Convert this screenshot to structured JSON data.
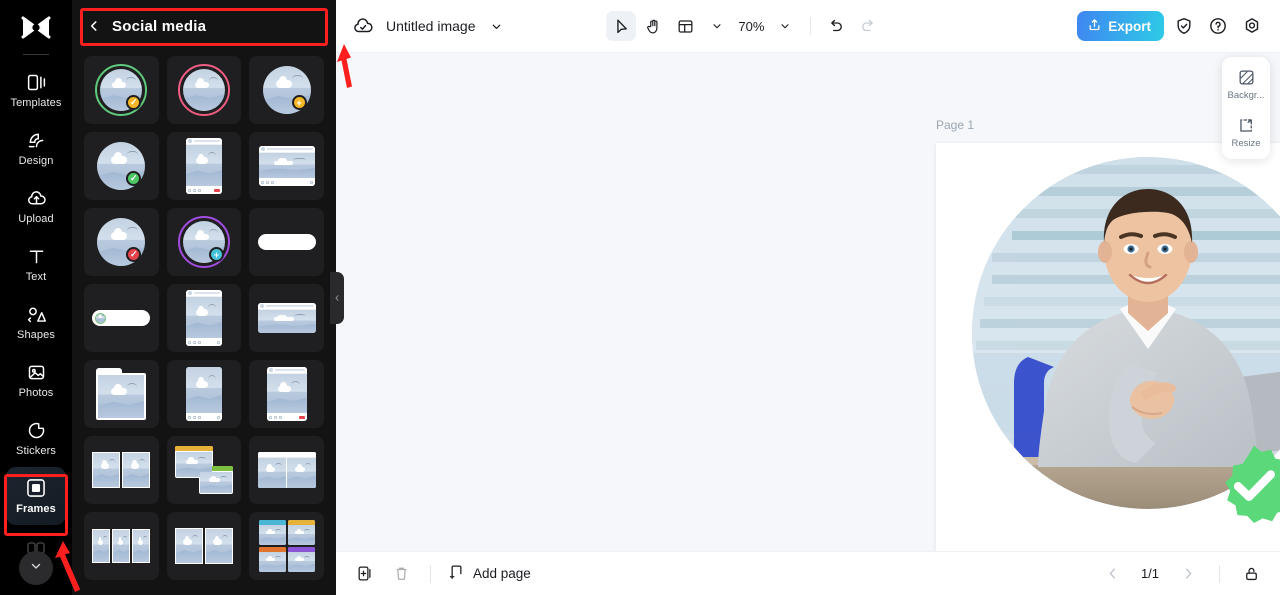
{
  "app": {
    "logo_icon": "capcut-logo-icon",
    "rail_items": [
      {
        "label": "Templates",
        "icon": "templates-icon",
        "active": false
      },
      {
        "label": "Design",
        "icon": "design-icon",
        "active": false
      },
      {
        "label": "Upload",
        "icon": "upload-cloud-icon",
        "active": false
      },
      {
        "label": "Text",
        "icon": "text-icon",
        "active": false
      },
      {
        "label": "Shapes",
        "icon": "shapes-icon",
        "active": false
      },
      {
        "label": "Photos",
        "icon": "photos-icon",
        "active": false
      },
      {
        "label": "Stickers",
        "icon": "stickers-icon",
        "active": false
      },
      {
        "label": "Frames",
        "icon": "frames-icon",
        "active": true
      }
    ],
    "rail_more_icon": "chevron-down-icon"
  },
  "panel": {
    "back_icon": "chevron-left-icon",
    "title": "Social media",
    "collapse_icon": "chevron-left-icon",
    "frames": [
      {
        "name": "circle-green-ring-frame",
        "kind": "ring-circle",
        "ring": "#5fc97c",
        "badge": "check",
        "badge_color": "#f5b728",
        "badge_pos": "br"
      },
      {
        "name": "circle-pink-ring-frame",
        "kind": "ring-circle",
        "ring": "#ef5d82",
        "badge": "",
        "badge_color": "",
        "badge_pos": ""
      },
      {
        "name": "circle-plus-badge-frame",
        "kind": "plain-circle",
        "ring": "",
        "badge": "plus",
        "badge_color": "#f5b728",
        "badge_pos": "br"
      },
      {
        "name": "circle-check-badge-frame",
        "kind": "plain-circle",
        "ring": "",
        "badge": "check",
        "badge_color": "#4cc764",
        "badge_pos": "br"
      },
      {
        "name": "story-post-card-frame",
        "kind": "card-portrait",
        "ring": "",
        "badge": "",
        "badge_color": "",
        "badge_pos": ""
      },
      {
        "name": "feed-post-card-frame",
        "kind": "card-landscape",
        "ring": "",
        "badge": "",
        "badge_color": "",
        "badge_pos": ""
      },
      {
        "name": "circle-x-badge-frame",
        "kind": "plain-circle",
        "ring": "",
        "badge": "check",
        "badge_color": "#e8434a",
        "badge_pos": "br"
      },
      {
        "name": "circle-purple-ring-frame",
        "kind": "ring-circle",
        "ring": "#a14de0",
        "badge": "plus",
        "badge_color": "#47c3d9",
        "badge_pos": "br"
      },
      {
        "name": "pill-bar-frame",
        "kind": "pill",
        "ring": "",
        "badge": "",
        "badge_color": "",
        "badge_pos": ""
      },
      {
        "name": "pill-avatar-frame",
        "kind": "pill-avatar",
        "ring": "#7bc47f",
        "badge": "",
        "badge_color": "",
        "badge_pos": ""
      },
      {
        "name": "post-window-frame",
        "kind": "card-portrait2",
        "ring": "",
        "badge": "",
        "badge_color": "",
        "badge_pos": ""
      },
      {
        "name": "wide-toolbar-frame",
        "kind": "card-wide",
        "ring": "",
        "badge": "",
        "badge_color": "",
        "badge_pos": ""
      },
      {
        "name": "folder-frame",
        "kind": "folder",
        "ring": "",
        "badge": "",
        "badge_color": "",
        "badge_pos": ""
      },
      {
        "name": "phone-post-frame",
        "kind": "card-phone",
        "ring": "",
        "badge": "",
        "badge_color": "",
        "badge_pos": ""
      },
      {
        "name": "social-post-frame",
        "kind": "card-social",
        "ring": "",
        "badge": "",
        "badge_color": "",
        "badge_pos": ""
      },
      {
        "name": "split-two-frame",
        "kind": "split2",
        "ring": "",
        "badge": "",
        "badge_color": "",
        "badge_pos": ""
      },
      {
        "name": "stacked-windows-frame",
        "kind": "stacked",
        "ring": "",
        "badge": "",
        "badge_color": "",
        "badge_pos": ""
      },
      {
        "name": "browser-two-frame",
        "kind": "browser2",
        "ring": "",
        "badge": "",
        "badge_color": "",
        "badge_pos": ""
      },
      {
        "name": "triple-split-frame",
        "kind": "split3",
        "ring": "",
        "badge": "",
        "badge_color": "",
        "badge_pos": ""
      },
      {
        "name": "double-split-frame",
        "kind": "split2b",
        "ring": "",
        "badge": "",
        "badge_color": "",
        "badge_pos": ""
      },
      {
        "name": "quad-color-frame",
        "kind": "quad",
        "ring": "",
        "badge": "",
        "badge_color": "",
        "badge_pos": ""
      }
    ]
  },
  "toolbar": {
    "cloud_icon": "cloud-saved-icon",
    "doc_title": "Untitled image",
    "title_chevron_icon": "chevron-down-icon",
    "select_tool_icon": "cursor-select-icon",
    "hand_tool_icon": "hand-pan-icon",
    "layout_tool_icon": "layout-grid-icon",
    "layout_chevron_icon": "chevron-down-icon",
    "zoom_value": "70%",
    "zoom_chevron_icon": "chevron-down-icon",
    "undo_icon": "undo-icon",
    "redo_icon": "redo-icon",
    "export_label": "Export",
    "export_icon": "upload-box-icon",
    "shield_icon": "shield-check-icon",
    "help_icon": "question-circle-icon",
    "settings_icon": "gear-icon"
  },
  "canvas": {
    "page_label": "Page 1",
    "duplicate_icon": "duplicate-page-icon",
    "more_icon": "more-horizontal-icon",
    "verified_badge_icon": "verified-check-badge-icon",
    "badge_color": "#5bd97a"
  },
  "right_panel": {
    "items": [
      {
        "label": "Backgr...",
        "icon": "background-swatch-icon"
      },
      {
        "label": "Resize",
        "icon": "resize-icon"
      }
    ]
  },
  "bottombar": {
    "duplicate_icon": "duplicate-page-icon",
    "delete_icon": "trash-icon",
    "add_page_icon": "add-page-icon",
    "add_page_label": "Add page",
    "prev_icon": "chevron-left-icon",
    "page_indicator": "1/1",
    "next_icon": "chevron-right-icon",
    "lock_icon": "lock-open-icon"
  },
  "annotations": {
    "highlight_color": "#ff1f1f",
    "boxes": [
      "panel-title-highlight",
      "frames-rail-highlight"
    ],
    "arrows": [
      "arrow-to-panel-title",
      "arrow-to-frames-item"
    ]
  },
  "colors": {
    "rail_bg": "#000000",
    "panel_bg": "#131313",
    "canvas_bg": "#f5f7fa",
    "export_from": "#3f86f2",
    "export_to": "#2dcbe6"
  }
}
